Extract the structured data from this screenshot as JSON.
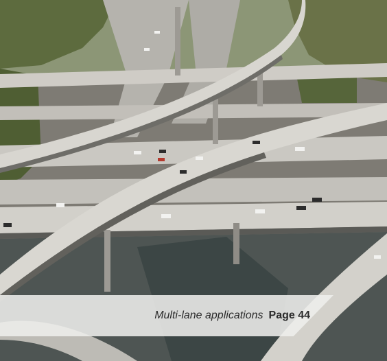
{
  "caption": {
    "title": "Multi-lane applications",
    "page_ref": "Page 44"
  },
  "colors": {
    "sky": "#b9c7c6",
    "trees": "#5d6b3e",
    "ground": "#7e7b74",
    "deck": "#c9c7c2",
    "shadow": "#5a5a56",
    "caption_bg": "#eeeeec"
  }
}
